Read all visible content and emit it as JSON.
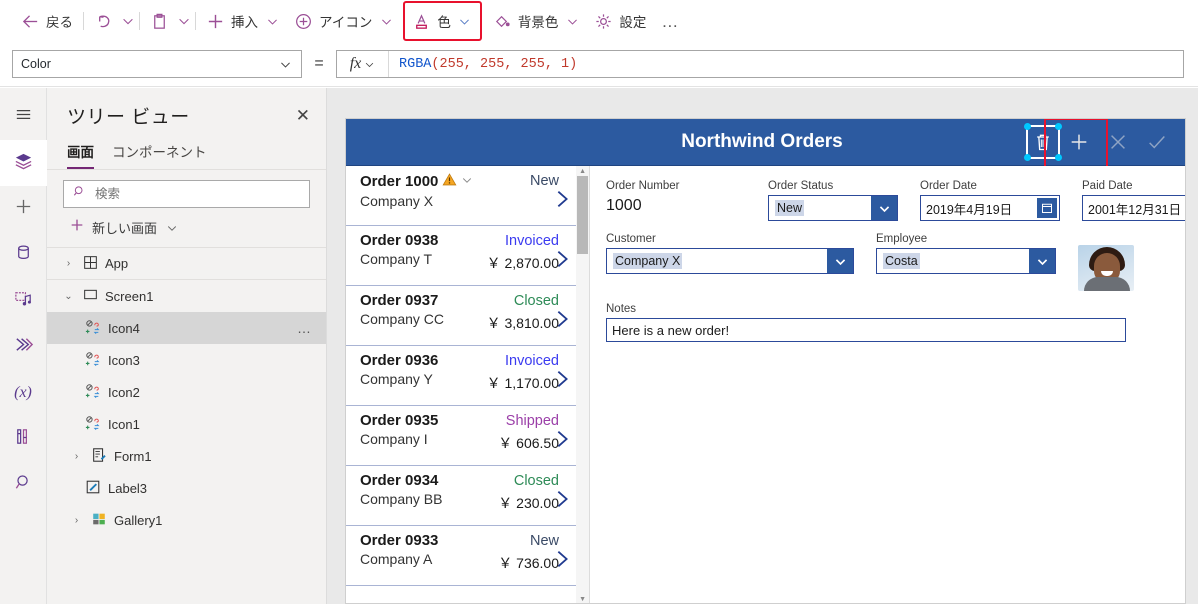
{
  "toolbar": {
    "back_label": "戻る",
    "insert_label": "挿入",
    "icon_label": "アイコン",
    "color_label": "色",
    "background_label": "背景色",
    "settings_label": "設定",
    "overflow_label": "…",
    "highlight_color": "#e8112d"
  },
  "formula_bar": {
    "property": "Color",
    "equals": "=",
    "fx": "fx",
    "formula_fn": "RGBA",
    "formula_args": "(255, 255, 255, 1)"
  },
  "rail": {
    "items": [
      {
        "name": "hamburger-menu-icon"
      },
      {
        "name": "tree-view-icon"
      },
      {
        "name": "insert-icon"
      },
      {
        "name": "data-icon"
      },
      {
        "name": "media-icon"
      },
      {
        "name": "power-automate-icon"
      },
      {
        "name": "variables-icon"
      },
      {
        "name": "advanced-tools-icon"
      },
      {
        "name": "search-icon"
      }
    ]
  },
  "tree_view": {
    "title": "ツリー ビュー",
    "close": "✕",
    "tabs": [
      {
        "label": "画面",
        "selected": true
      },
      {
        "label": "コンポーネント",
        "selected": false
      }
    ],
    "search_placeholder": "検索",
    "search_value": "",
    "new_screen_label": "新しい画面",
    "items": [
      {
        "label": "App",
        "indent": 0,
        "expander": "›",
        "icon": "app-icon",
        "selected": false
      },
      {
        "label": "Screen1",
        "indent": 0,
        "expander": "⌄",
        "icon": "screen-icon",
        "selected": false
      },
      {
        "label": "Icon4",
        "indent": 1,
        "expander": "",
        "icon": "icon-control-icon",
        "selected": true,
        "more": "…"
      },
      {
        "label": "Icon3",
        "indent": 1,
        "expander": "",
        "icon": "icon-control-icon",
        "selected": false
      },
      {
        "label": "Icon2",
        "indent": 1,
        "expander": "",
        "icon": "icon-control-icon",
        "selected": false
      },
      {
        "label": "Icon1",
        "indent": 1,
        "expander": "",
        "icon": "icon-control-icon",
        "selected": false
      },
      {
        "label": "Form1",
        "indent": 1,
        "expander": "›",
        "icon": "form-icon",
        "selected": false
      },
      {
        "label": "Label3",
        "indent": 1,
        "expander": "",
        "icon": "label-icon",
        "selected": false
      },
      {
        "label": "Gallery1",
        "indent": 1,
        "expander": "›",
        "icon": "gallery-icon",
        "selected": false
      }
    ]
  },
  "app_preview": {
    "title": "Northwind Orders",
    "header_color": "#2c5aa0",
    "header_icons": [
      {
        "name": "trash-icon",
        "selected": true
      },
      {
        "name": "plus-icon",
        "selected": false
      },
      {
        "name": "cancel-icon",
        "selected": false
      },
      {
        "name": "check-icon",
        "selected": false
      }
    ],
    "gallery": [
      {
        "order": "Order 1000",
        "company": "Company X",
        "status": "New",
        "status_color": "#3a4a66",
        "amount": "",
        "warning": true
      },
      {
        "order": "Order 0938",
        "company": "Company T",
        "status": "Invoiced",
        "status_color": "#3b3bf0",
        "amount": "￥ 2,870.00",
        "warning": false
      },
      {
        "order": "Order 0937",
        "company": "Company CC",
        "status": "Closed",
        "status_color": "#2e8b57",
        "amount": "￥ 3,810.00",
        "warning": false
      },
      {
        "order": "Order 0936",
        "company": "Company Y",
        "status": "Invoiced",
        "status_color": "#3b3bf0",
        "amount": "￥ 1,170.00",
        "warning": false
      },
      {
        "order": "Order 0935",
        "company": "Company I",
        "status": "Shipped",
        "status_color": "#9b3fa8",
        "amount": "￥ 606.50",
        "warning": false
      },
      {
        "order": "Order 0934",
        "company": "Company BB",
        "status": "Closed",
        "status_color": "#2e8b57",
        "amount": "￥ 230.00",
        "warning": false
      },
      {
        "order": "Order 0933",
        "company": "Company A",
        "status": "New",
        "status_color": "#3a4a66",
        "amount": "￥ 736.00",
        "warning": false
      }
    ],
    "form": {
      "order_number_label": "Order Number",
      "order_number_value": "1000",
      "order_status_label": "Order Status",
      "order_status_value": "New",
      "order_date_label": "Order Date",
      "order_date_value": "2019年4月19日",
      "paid_date_label": "Paid Date",
      "paid_date_value": "2001年12月31日",
      "customer_label": "Customer",
      "customer_value": "Company X",
      "employee_label": "Employee",
      "employee_value": "Costa",
      "notes_label": "Notes",
      "notes_value": "Here is a new order!"
    }
  }
}
